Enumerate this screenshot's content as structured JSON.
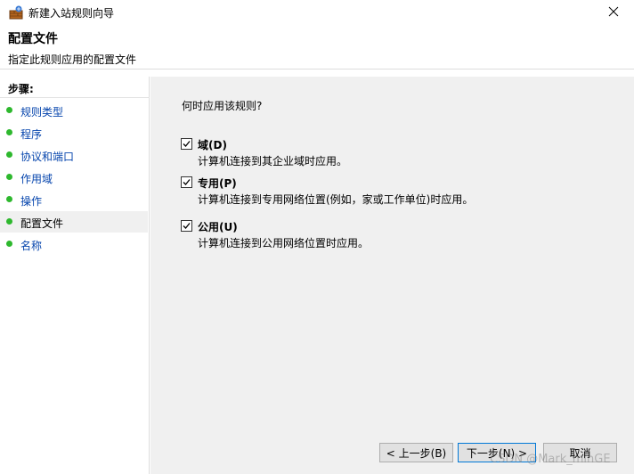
{
  "window": {
    "title": "新建入站规则向导",
    "app_icon": "firewall-wizard-icon",
    "close_icon": "close-icon"
  },
  "header": {
    "title": "配置文件",
    "subtitle": "指定此规则应用的配置文件"
  },
  "sidebar": {
    "steps_label": "步骤:",
    "items": [
      {
        "label": "规则类型",
        "current": false
      },
      {
        "label": "程序",
        "current": false
      },
      {
        "label": "协议和端口",
        "current": false
      },
      {
        "label": "作用域",
        "current": false
      },
      {
        "label": "操作",
        "current": false
      },
      {
        "label": "配置文件",
        "current": true
      },
      {
        "label": "名称",
        "current": false
      }
    ]
  },
  "main": {
    "question": "何时应用该规则?",
    "options": [
      {
        "label": "域(D)",
        "description": "计算机连接到其企业域时应用。",
        "checked": true
      },
      {
        "label": "专用(P)",
        "description": "计算机连接到专用网络位置(例如，家或工作单位)时应用。",
        "checked": true
      },
      {
        "label": "公用(U)",
        "description": "计算机连接到公用网络位置时应用。",
        "checked": true
      }
    ]
  },
  "buttons": {
    "back": "< 上一步(B)",
    "next": "下一步(N) >",
    "cancel": "取消"
  },
  "watermark": "CSDN @Mark_minGE",
  "colors": {
    "step_dot": "#2eb82e",
    "link": "#0645ad",
    "content_bg": "#f0f0f0",
    "primary_border": "#0078d7"
  }
}
